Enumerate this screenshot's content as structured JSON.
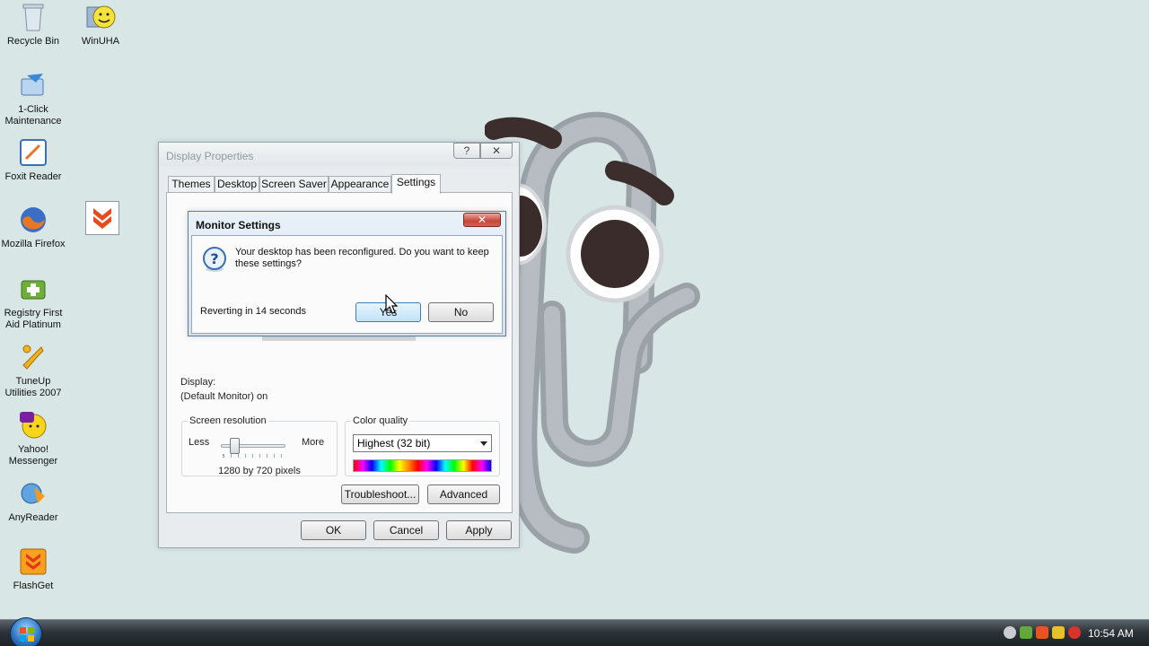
{
  "desktop_icons": [
    {
      "name": "recycle-bin",
      "label": "Recycle Bin"
    },
    {
      "name": "winuha",
      "label": "WinUHA"
    },
    {
      "name": "one-click-maintenance",
      "label": "1-Click\nMaintenance"
    },
    {
      "name": "foxit-reader",
      "label": "Foxit Reader"
    },
    {
      "name": "mozilla-firefox",
      "label": "Mozilla Firefox"
    },
    {
      "name": "flashget-shortcut",
      "label": ""
    },
    {
      "name": "registry-first-aid",
      "label": "Registry First\nAid Platinum"
    },
    {
      "name": "tuneup-utilities",
      "label": "TuneUp\nUtilities 2007"
    },
    {
      "name": "yahoo-messenger",
      "label": "Yahoo!\nMessenger"
    },
    {
      "name": "anyreader",
      "label": "AnyReader"
    },
    {
      "name": "flashget",
      "label": "FlashGet"
    }
  ],
  "display_properties": {
    "title": "Display Properties",
    "help_label": "?",
    "close_label": "✕",
    "tabs": [
      "Themes",
      "Desktop",
      "Screen Saver",
      "Appearance",
      "Settings"
    ],
    "active_tab": "Settings",
    "display_label": "Display:",
    "display_value": "(Default Monitor) on",
    "screen_resolution": {
      "title": "Screen resolution",
      "less": "Less",
      "more": "More",
      "value_text": "1280 by 720 pixels"
    },
    "color_quality": {
      "title": "Color quality",
      "selected": "Highest (32 bit)"
    },
    "buttons": {
      "troubleshoot": "Troubleshoot...",
      "advanced": "Advanced",
      "ok": "OK",
      "cancel": "Cancel",
      "apply": "Apply"
    }
  },
  "monitor_settings": {
    "title": "Monitor Settings",
    "close_label": "✕",
    "message": "Your desktop has been reconfigured.  Do you want to keep these settings?",
    "revert_text": "Reverting in 14 seconds",
    "yes_label": "Yes",
    "no_label": "No"
  },
  "taskbar": {
    "clock": "10:54 AM"
  }
}
